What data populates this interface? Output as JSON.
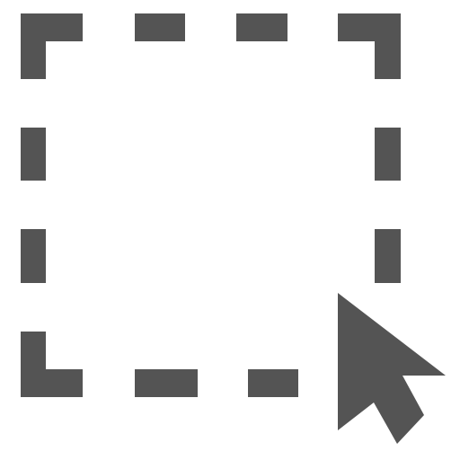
{
  "icon": {
    "name": "marquee-select-icon",
    "color": "#545454",
    "background": "#ffffff"
  }
}
